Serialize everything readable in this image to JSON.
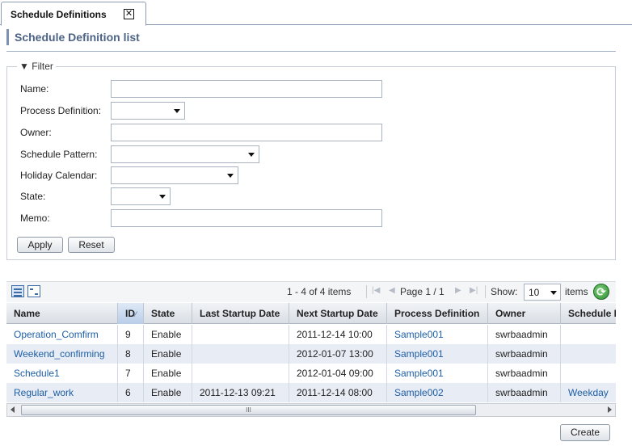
{
  "tab": {
    "title": "Schedule Definitions",
    "close_glyph": "✕"
  },
  "page": {
    "title": "Schedule Definition list"
  },
  "filter": {
    "legend": "Filter",
    "fields": {
      "name": "Name:",
      "process_definition": "Process Definition:",
      "owner": "Owner:",
      "schedule_pattern": "Schedule Pattern:",
      "holiday_calendar": "Holiday Calendar:",
      "state": "State:",
      "memo": "Memo:"
    },
    "apply_label": "Apply",
    "reset_label": "Reset"
  },
  "toolbar": {
    "items_range": "1 - 4 of 4 items",
    "page_text": "Page 1 / 1",
    "show_label": "Show:",
    "show_value": "10",
    "items_label": "items"
  },
  "grid": {
    "columns": [
      "Name",
      "ID",
      "State",
      "Last Startup Date",
      "Next Startup Date",
      "Process Definition",
      "Owner",
      "Schedule Pattern"
    ],
    "sorted_column": "ID",
    "rows": [
      {
        "name": "Operation_Comfirm",
        "id": "9",
        "state": "Enable",
        "last": "",
        "next": "2011-12-14 10:00",
        "process": "Sample001",
        "owner": "swrbaadmin",
        "pattern": ""
      },
      {
        "name": "Weekend_confirming",
        "id": "8",
        "state": "Enable",
        "last": "",
        "next": "2012-01-07 13:00",
        "process": "Sample001",
        "owner": "swrbaadmin",
        "pattern": ""
      },
      {
        "name": "Schedule1",
        "id": "7",
        "state": "Enable",
        "last": "",
        "next": "2012-01-04 09:00",
        "process": "Sample001",
        "owner": "swrbaadmin",
        "pattern": ""
      },
      {
        "name": "Regular_work",
        "id": "6",
        "state": "Enable",
        "last": "2011-12-13 09:21",
        "next": "2011-12-14 08:00",
        "process": "Sample002",
        "owner": "swrbaadmin",
        "pattern": "Weekday"
      }
    ]
  },
  "scrollbar": {
    "thumb_grip": "III"
  },
  "actions": {
    "create_label": "Create"
  },
  "colors": {
    "link": "#1d5fa6",
    "header_accent": "#4d6386",
    "alt_row": "#e8ecf4"
  }
}
